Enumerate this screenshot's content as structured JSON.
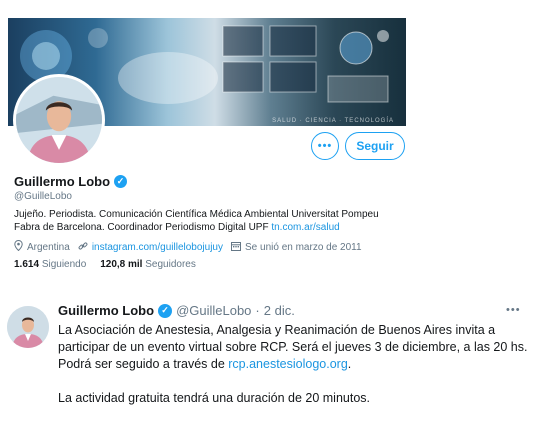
{
  "profile": {
    "banner_caption": "SALUD · CIENCIA · TECNOLOGÍA",
    "name": "Guillermo Lobo",
    "handle": "@GuilleLobo",
    "bio_text": "Jujeño. Periodista. Comunicación Científica Médica Ambiental Universitat Pompeu Fabra de Barcelona. Coordinador Periodismo Digital UPF ",
    "bio_link": "tn.com.ar/salud",
    "location": "Argentina",
    "website": "instagram.com/guillelobojujuy",
    "joined": "Se unió en marzo de 2011",
    "following_count": "1.614",
    "following_label": "Siguiendo",
    "followers_count": "120,8 mil",
    "followers_label": "Seguidores",
    "more_label": "•••",
    "follow_label": "Seguir",
    "icons": {
      "verified": "verified-badge-icon",
      "location": "location-pin-icon",
      "link": "link-icon",
      "calendar": "calendar-icon"
    }
  },
  "tweet": {
    "name": "Guillermo Lobo",
    "handle": "@GuilleLobo",
    "separator": "·",
    "date": "2 dic.",
    "more_label": "•••",
    "body_part1": "La Asociación de Anestesia, Analgesia y Reanimación de Buenos Aires invita a participar de un evento virtual sobre RCP. Será el jueves 3 de diciembre, a las 20 hs. Podrá ser seguido a través de ",
    "body_link": "rcp.anestesiologo.org",
    "body_part1_end": ".",
    "body_part2": "La actividad gratuita tendrá una duración de 20 minutos."
  },
  "colors": {
    "accent": "#1da1f2",
    "link": "#1b95e0",
    "secondary_text": "#657786",
    "primary_text": "#14171a"
  }
}
